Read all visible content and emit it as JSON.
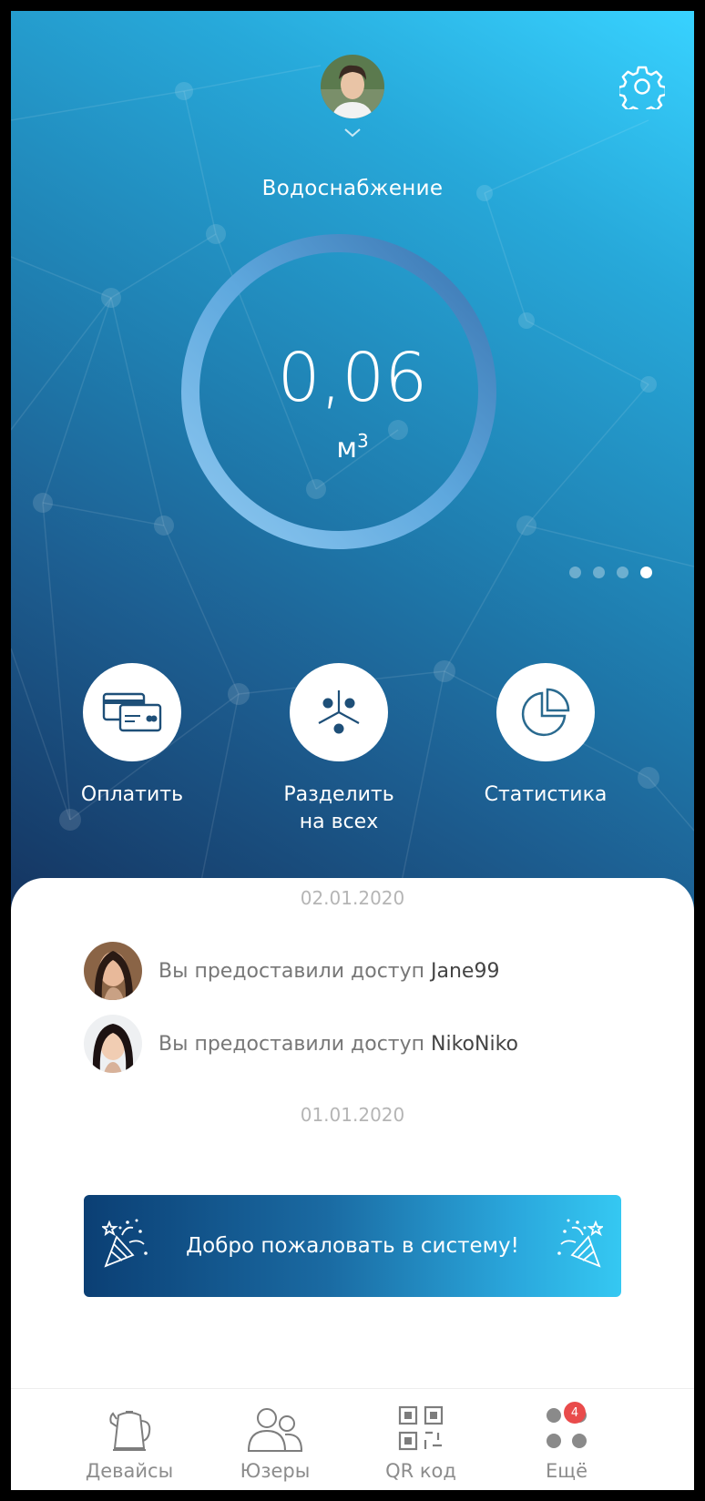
{
  "header": {
    "title": "Водоснабжение"
  },
  "meter": {
    "value": "0,06",
    "unit": "м",
    "unit_power": "3",
    "progress": 1.0
  },
  "pager": {
    "count": 4,
    "active_index": 3
  },
  "actions": [
    {
      "label": "Оплатить",
      "icon": "credit-cards-icon"
    },
    {
      "label_line1": "Разделить",
      "label_line2": "на всех",
      "icon": "split-icon"
    },
    {
      "label": "Статистика",
      "icon": "pie-chart-icon"
    }
  ],
  "feed": {
    "groups": [
      {
        "date": "02.01.2020",
        "items": [
          {
            "text": "Вы предоставили доступ",
            "user": "Jane99"
          },
          {
            "text": "Вы предоставили доступ",
            "user": "NikoNiko"
          }
        ]
      },
      {
        "date": "01.01.2020"
      }
    ],
    "banner": {
      "text": "Добро пожаловать в систему!",
      "icon": "party-popper-icon"
    }
  },
  "tabbar": {
    "items": [
      {
        "label": "Девайсы",
        "icon": "kettle-icon"
      },
      {
        "label": "Юзеры",
        "icon": "users-icon"
      },
      {
        "label": "QR код",
        "icon": "qr-code-icon"
      },
      {
        "label": "Ещё",
        "icon": "more-dots-icon",
        "badge": "4"
      }
    ]
  },
  "colors": {
    "hero_top": "#38d2ff",
    "hero_bottom": "#14335f",
    "badge": "#e94b4b"
  }
}
